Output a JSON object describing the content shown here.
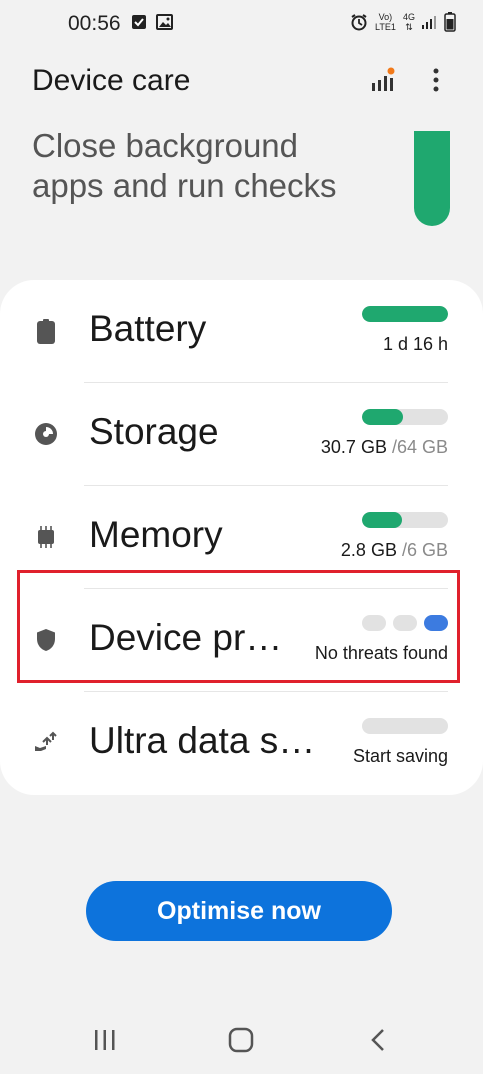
{
  "status_bar": {
    "time": "00:56",
    "volte_label": "Vo)",
    "lte_label": "LTE1",
    "net_label": "4G"
  },
  "header": {
    "title": "Device care",
    "diagnostics_icon": "signal-bars-icon",
    "more_icon": "more-vert-icon"
  },
  "hero": {
    "line1": "Close background",
    "line2": "apps and run checks"
  },
  "items": [
    {
      "label": "Battery",
      "value": "1 d 16 h",
      "total": "",
      "level": 1.0,
      "icon": "battery-icon"
    },
    {
      "label": "Storage",
      "value": "30.7 GB",
      "total": "/64 GB",
      "level": 0.48,
      "icon": "storage-pie-icon"
    },
    {
      "label": "Memory",
      "value": "2.8 GB",
      "total": "/6 GB",
      "level": 0.47,
      "icon": "chip-icon"
    },
    {
      "label": "Device pr…",
      "value": "No threats found",
      "total": "",
      "icon": "shield-icon"
    },
    {
      "label": "Ultra data s…",
      "value": "Start saving",
      "total": "",
      "level": 0.0,
      "icon": "data-saver-icon"
    }
  ],
  "optimise_button": "Optimise now",
  "colors": {
    "accent_green": "#1fa86f",
    "button_blue": "#0d73dc",
    "highlight_red": "#e0202c",
    "dot_blue": "#3c7be0"
  }
}
